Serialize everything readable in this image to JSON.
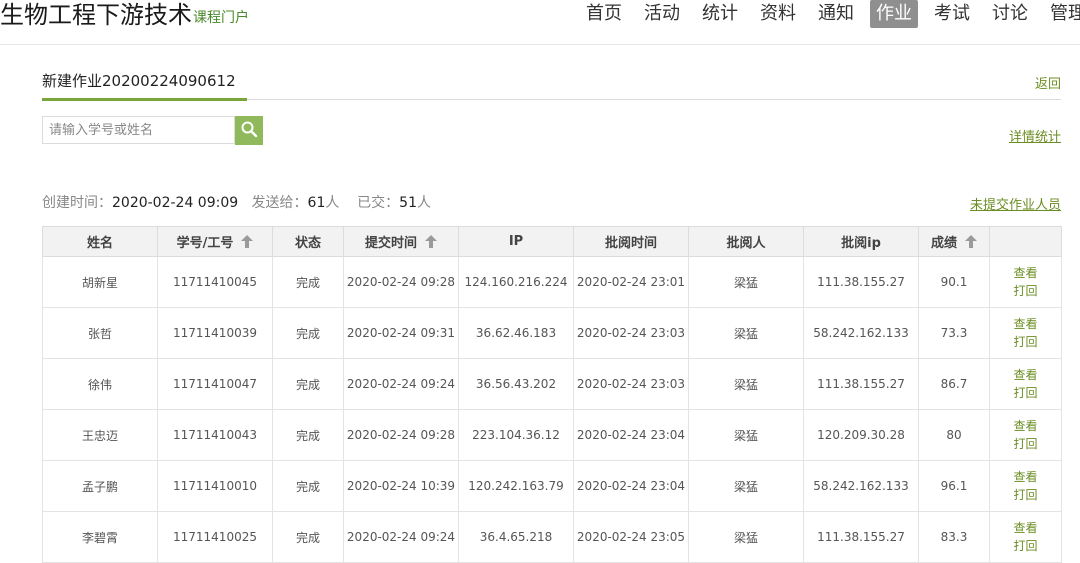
{
  "header": {
    "course_title": "生物工程下游技术",
    "portal_link": "课程门户",
    "nav": [
      {
        "label": "首页",
        "active": false
      },
      {
        "label": "活动",
        "active": false
      },
      {
        "label": "统计",
        "active": false
      },
      {
        "label": "资料",
        "active": false
      },
      {
        "label": "通知",
        "active": false
      },
      {
        "label": "作业",
        "active": true
      },
      {
        "label": "考试",
        "active": false
      },
      {
        "label": "讨论",
        "active": false
      },
      {
        "label": "管理",
        "active": false
      }
    ]
  },
  "homework": {
    "title": "新建作业20200224090612",
    "back_label": "返回"
  },
  "search": {
    "placeholder": "请输入学号或姓名",
    "button_icon": "search-icon"
  },
  "links": {
    "detail_stats": "详情统计",
    "unsubmitted": "未提交作业人员"
  },
  "info": {
    "created_label": "创建时间：",
    "created_value": "2020-02-24 09:09",
    "sent_label": "发送给：",
    "sent_value": "61",
    "sent_unit": "人",
    "submitted_label": "已交：",
    "submitted_value": "51",
    "submitted_unit": "人"
  },
  "table": {
    "columns": [
      "姓名",
      "学号/工号",
      "状态",
      "提交时间",
      "IP",
      "批阅时间",
      "批阅人",
      "批阅ip",
      "成绩",
      ""
    ],
    "sortable_columns": [
      1,
      3,
      8
    ],
    "action_labels": {
      "view": "查看",
      "print": "打回"
    },
    "rows": [
      {
        "name": "胡新星",
        "id": "11711410045",
        "status": "完成",
        "submit_time": "2020-02-24 09:28",
        "ip": "124.160.216.224",
        "review_time": "2020-02-24 23:01",
        "reviewer": "梁猛",
        "review_ip": "111.38.155.27",
        "score": "90.1"
      },
      {
        "name": "张哲",
        "id": "11711410039",
        "status": "完成",
        "submit_time": "2020-02-24 09:31",
        "ip": "36.62.46.183",
        "review_time": "2020-02-24 23:03",
        "reviewer": "梁猛",
        "review_ip": "58.242.162.133",
        "score": "73.3"
      },
      {
        "name": "徐伟",
        "id": "11711410047",
        "status": "完成",
        "submit_time": "2020-02-24 09:24",
        "ip": "36.56.43.202",
        "review_time": "2020-02-24 23:03",
        "reviewer": "梁猛",
        "review_ip": "111.38.155.27",
        "score": "86.7"
      },
      {
        "name": "王忠迈",
        "id": "11711410043",
        "status": "完成",
        "submit_time": "2020-02-24 09:28",
        "ip": "223.104.36.12",
        "review_time": "2020-02-24 23:04",
        "reviewer": "梁猛",
        "review_ip": "120.209.30.28",
        "score": "80"
      },
      {
        "name": "孟子鹏",
        "id": "11711410010",
        "status": "完成",
        "submit_time": "2020-02-24 10:39",
        "ip": "120.242.163.79",
        "review_time": "2020-02-24 23:04",
        "reviewer": "梁猛",
        "review_ip": "58.242.162.133",
        "score": "96.1"
      },
      {
        "name": "李碧霄",
        "id": "11711410025",
        "status": "完成",
        "submit_time": "2020-02-24 09:24",
        "ip": "36.4.65.218",
        "review_time": "2020-02-24 23:05",
        "reviewer": "梁猛",
        "review_ip": "111.38.155.27",
        "score": "83.3"
      }
    ]
  },
  "colors": {
    "accent_green": "#6b8e23",
    "search_button": "#8fb95a",
    "active_nav_bg": "#8f8f8f"
  }
}
